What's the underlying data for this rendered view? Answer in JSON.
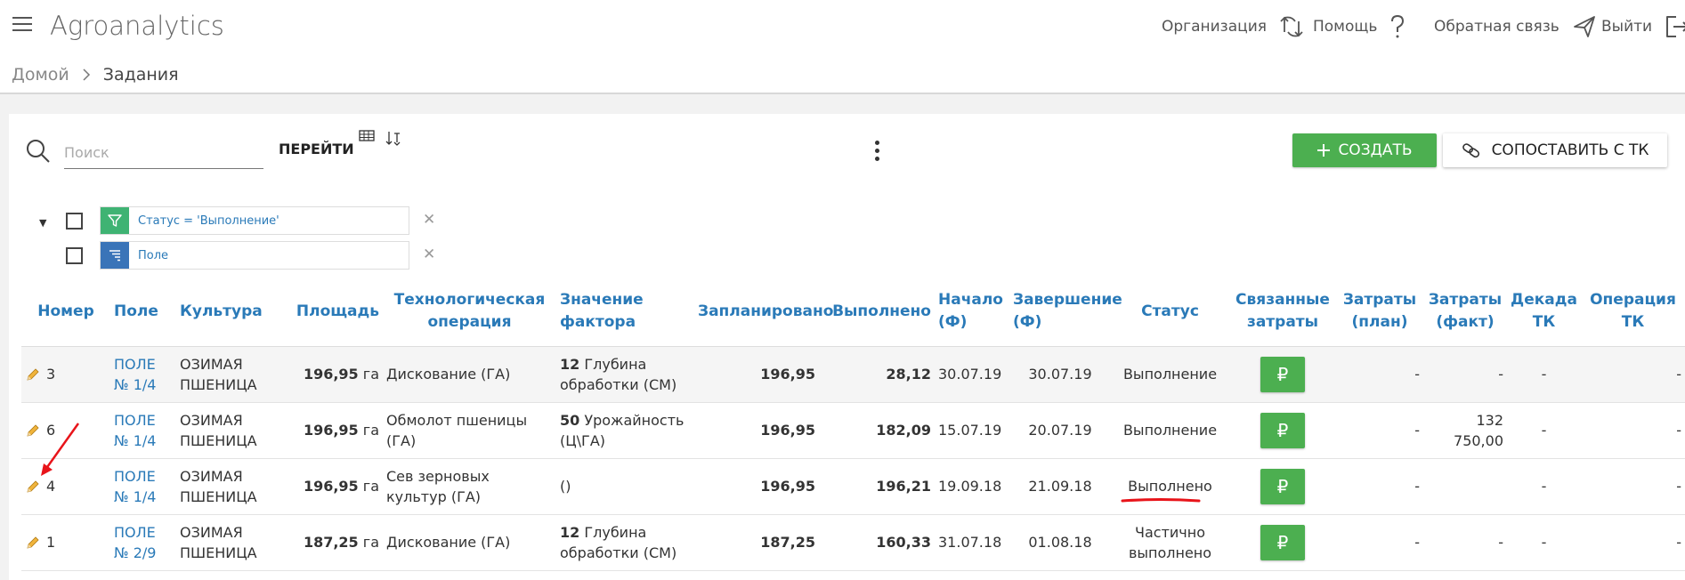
{
  "header": {
    "app_title": "Agroanalytics",
    "links": [
      {
        "label": "Организация",
        "icon": "sync-icon"
      },
      {
        "label": "Помощь",
        "icon": "help-icon"
      },
      {
        "label": "Обратная связь",
        "icon": "send-icon"
      },
      {
        "label": "Выйти",
        "icon": "logout-icon"
      }
    ]
  },
  "breadcrumb": {
    "home": "Домой",
    "current": "Задания"
  },
  "toolbar": {
    "search_placeholder": "Поиск",
    "go_label": "ПЕРЕЙТИ",
    "create_label": "СОЗДАТЬ",
    "compare_label": "СОПОСТАВИТЬ С ТК"
  },
  "filters": [
    {
      "label": "Статус = 'Выполнение'",
      "icon": "filter-icon",
      "color": "#3fb373"
    },
    {
      "label": "Поле",
      "icon": "sort-icon",
      "color": "#3a74b8"
    }
  ],
  "table": {
    "headers": {
      "number": "Номер",
      "field": "Поле",
      "culture": "Культура",
      "area": "Площадь",
      "tech_op": "Технологическая операция",
      "factor": "Значение фактора",
      "planned": "Запланировано",
      "done": "Выполнено",
      "start": "Начало (Ф)",
      "end": "Завершение (Ф)",
      "status": "Статус",
      "linked": "Связанные затраты",
      "cost_plan": "Затраты (план)",
      "cost_fact": "Затраты (факт)",
      "decade": "Декада ТК",
      "op_tk": "Операция ТК"
    },
    "rows": [
      {
        "number": "3",
        "field": "ПОЛЕ № 1/4",
        "culture": "ОЗИМАЯ ПШЕНИЦА",
        "area_value": "196,95",
        "area_unit": "га",
        "tech_op": "Дискование (ГА)",
        "factor_value": "12",
        "factor_text": "Глубина обработки (СМ)",
        "planned": "196,95",
        "done": "28,12",
        "start": "30.07.19",
        "end": "30.07.19",
        "status": "Выполнение",
        "linked": "₽",
        "cost_plan": "-",
        "cost_fact": "-",
        "decade": "-",
        "op_tk": "-"
      },
      {
        "number": "6",
        "field": "ПОЛЕ № 1/4",
        "culture": "ОЗИМАЯ ПШЕНИЦА",
        "area_value": "196,95",
        "area_unit": "га",
        "tech_op": "Обмолот пшеницы (ГА)",
        "factor_value": "50",
        "factor_text": "Урожайность (Ц\\ГА)",
        "planned": "196,95",
        "done": "182,09",
        "start": "15.07.19",
        "end": "20.07.19",
        "status": "Выполнение",
        "linked": "₽",
        "cost_plan": "-",
        "cost_fact": "132 750,00",
        "decade": "-",
        "op_tk": "-"
      },
      {
        "number": "4",
        "field": "ПОЛЕ № 1/4",
        "culture": "ОЗИМАЯ ПШЕНИЦА",
        "area_value": "196,95",
        "area_unit": "га",
        "tech_op": "Сев зерновых культур (ГА)",
        "factor_value": "",
        "factor_text": "()",
        "planned": "196,95",
        "done": "196,21",
        "start": "19.09.18",
        "end": "21.09.18",
        "status": "Выполнено",
        "linked": "₽",
        "cost_plan": "-",
        "cost_fact": "",
        "decade": "-",
        "op_tk": "-"
      },
      {
        "number": "1",
        "field": "ПОЛЕ № 2/9",
        "culture": "ОЗИМАЯ ПШЕНИЦА",
        "area_value": "187,25",
        "area_unit": "га",
        "tech_op": "Дискование (ГА)",
        "factor_value": "12",
        "factor_text": "Глубина обработки (СМ)",
        "planned": "187,25",
        "done": "160,33",
        "start": "31.07.18",
        "end": "01.08.18",
        "status": "Частично выполнено",
        "linked": "₽",
        "cost_plan": "-",
        "cost_fact": "-",
        "decade": "-",
        "op_tk": "-"
      }
    ]
  },
  "colors": {
    "accent_blue": "#2a7ab8",
    "button_green": "#4caf50",
    "annotation_red": "#e8141a"
  }
}
